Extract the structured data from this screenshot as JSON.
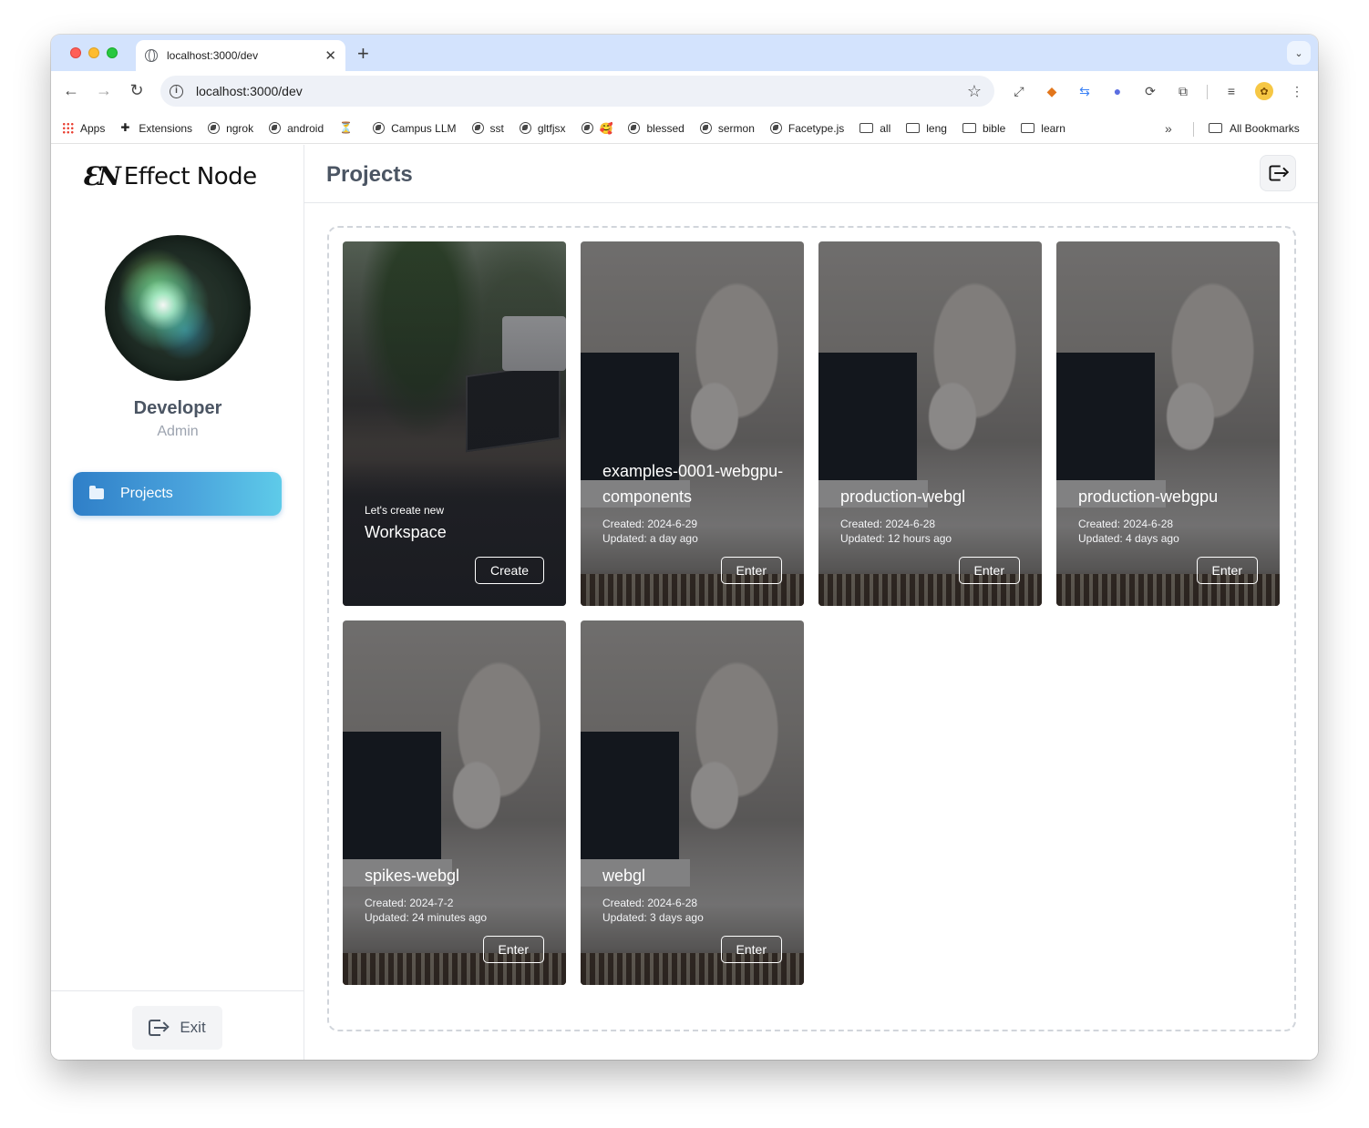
{
  "browser": {
    "tab_title": "localhost:3000/dev",
    "new_tab": "+",
    "url": "localhost:3000/dev",
    "bookmarks": [
      {
        "label": "Apps",
        "icon": "apps-grid-icon"
      },
      {
        "label": "Extensions",
        "icon": "puzzle-icon"
      },
      {
        "label": "ngrok",
        "icon": "globe-icon"
      },
      {
        "label": "android",
        "icon": "globe-icon"
      },
      {
        "label": "",
        "icon": "flask-icon"
      },
      {
        "label": "Campus LLM",
        "icon": "globe-icon"
      },
      {
        "label": "sst",
        "icon": "globe-icon"
      },
      {
        "label": "gltfjsx",
        "icon": "globe-icon"
      },
      {
        "label": "🥰",
        "icon": "globe-icon"
      },
      {
        "label": "blessed",
        "icon": "globe-icon"
      },
      {
        "label": "sermon",
        "icon": "globe-icon"
      },
      {
        "label": "Facetype.js",
        "icon": "globe-icon"
      },
      {
        "label": "all",
        "icon": "folder-icon"
      },
      {
        "label": "leng",
        "icon": "folder-icon"
      },
      {
        "label": "bible",
        "icon": "folder-icon"
      },
      {
        "label": "learn",
        "icon": "folder-icon"
      }
    ],
    "more_bookmarks": "»",
    "all_bookmarks": "All Bookmarks"
  },
  "app": {
    "logo_mark": "ƐN",
    "logo_text": "Effect Node",
    "page_title": "Projects",
    "user": {
      "name": "Developer",
      "role": "Admin"
    },
    "nav": {
      "projects": "Projects"
    },
    "exit_label": "Exit",
    "create_card": {
      "kicker": "Let's create new",
      "title": "Workspace",
      "button": "Create"
    },
    "projects": [
      {
        "name": "examples-0001-webgpu-components",
        "created": "Created: 2024-6-29",
        "updated": "Updated: a day ago",
        "button": "Enter"
      },
      {
        "name": "production-webgl",
        "created": "Created: 2024-6-28",
        "updated": "Updated: 12 hours ago",
        "button": "Enter"
      },
      {
        "name": "production-webgpu",
        "created": "Created: 2024-6-28",
        "updated": "Updated: 4 days ago",
        "button": "Enter"
      },
      {
        "name": "spikes-webgl",
        "created": "Created: 2024-7-2",
        "updated": "Updated: 24 minutes ago",
        "button": "Enter"
      },
      {
        "name": "webgl",
        "created": "Created: 2024-6-28",
        "updated": "Updated: 3 days ago",
        "button": "Enter"
      }
    ]
  },
  "colors": {
    "accent_gradient_start": "#2f7fc8",
    "accent_gradient_end": "#5ecbe9",
    "tabstrip": "#d3e3fd"
  }
}
